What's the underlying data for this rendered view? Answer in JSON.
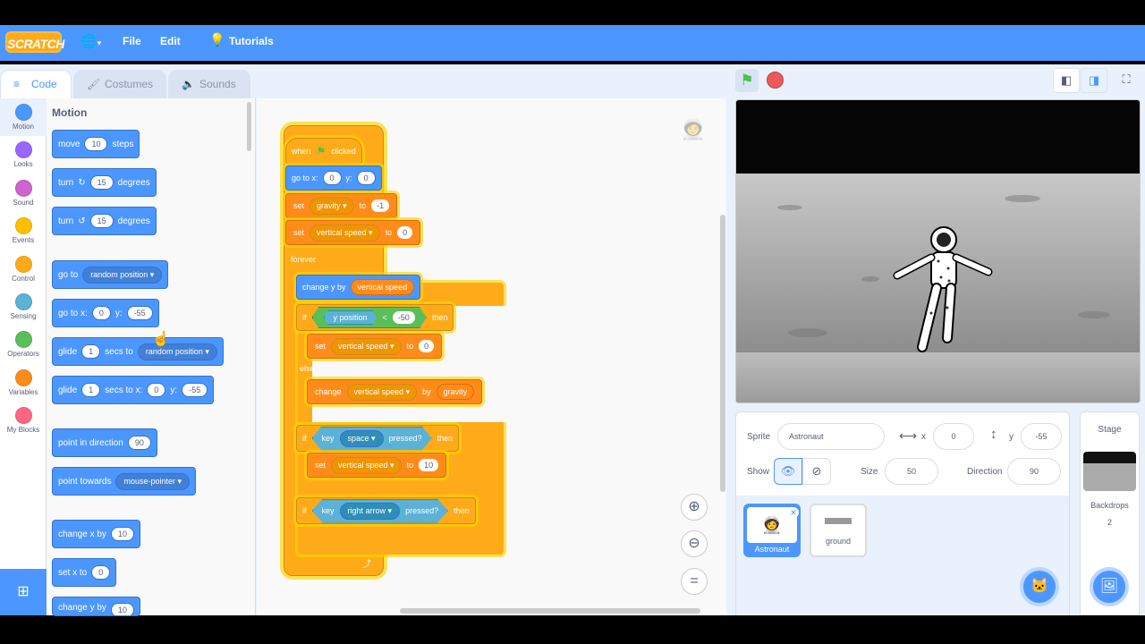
{
  "menu": {
    "logo": "SCRATCH",
    "globe_icon": "globe-icon",
    "file": "File",
    "edit": "Edit",
    "tutorials": "Tutorials"
  },
  "tabs": {
    "code": "Code",
    "costumes": "Costumes",
    "sounds": "Sounds"
  },
  "categories": [
    {
      "label": "Motion",
      "color": "#4c97ff"
    },
    {
      "label": "Looks",
      "color": "#9966ff"
    },
    {
      "label": "Sound",
      "color": "#cf63cf"
    },
    {
      "label": "Events",
      "color": "#ffbf00"
    },
    {
      "label": "Control",
      "color": "#ffab19"
    },
    {
      "label": "Sensing",
      "color": "#5cb1d6"
    },
    {
      "label": "Operators",
      "color": "#59c059"
    },
    {
      "label": "Variables",
      "color": "#ff8c1a"
    },
    {
      "label": "My Blocks",
      "color": "#ff6680"
    }
  ],
  "palette": {
    "title": "Motion",
    "move": {
      "a": "move",
      "v": "10",
      "b": "steps"
    },
    "turn_right": {
      "a": "turn",
      "v": "15",
      "b": "degrees"
    },
    "turn_left": {
      "a": "turn",
      "v": "15",
      "b": "degrees"
    },
    "goto": {
      "a": "go to",
      "d": "random position"
    },
    "gotoxy": {
      "a": "go to x:",
      "x": "0",
      "b": "y:",
      "y": "-55"
    },
    "glide": {
      "a": "glide",
      "v": "1",
      "b": "secs to",
      "d": "random position"
    },
    "glidexy": {
      "a": "glide",
      "v": "1",
      "b": "secs to x:",
      "x": "0",
      "c": "y:",
      "y": "-55"
    },
    "point_dir": {
      "a": "point in direction",
      "v": "90"
    },
    "point_towards": {
      "a": "point towards",
      "d": "mouse-pointer"
    },
    "change_x": {
      "a": "change x by",
      "v": "10"
    },
    "set_x": {
      "a": "set x to",
      "v": "0"
    },
    "change_y": {
      "a": "change y by",
      "v": "10"
    }
  },
  "script": {
    "hat": {
      "a": "when",
      "b": "clicked"
    },
    "gotoxy": {
      "a": "go to x:",
      "x": "0",
      "b": "y:",
      "y": "0"
    },
    "set_gravity": {
      "a": "set",
      "d": "gravity",
      "b": "to",
      "v": "-1"
    },
    "set_vs": {
      "a": "set",
      "d": "vertical speed",
      "b": "to",
      "v": "0"
    },
    "forever": "forever",
    "change_y": {
      "a": "change y by",
      "v": "vertical speed"
    },
    "if1": {
      "a": "if",
      "s": "y position",
      "op": "<",
      "v": "-50",
      "b": "then"
    },
    "set_vs2": {
      "a": "set",
      "d": "vertical speed",
      "b": "to",
      "v": "0"
    },
    "else": "else",
    "change_vs": {
      "a": "change",
      "d": "vertical speed",
      "b": "by",
      "v": "gravity"
    },
    "if2": {
      "a": "if",
      "k": "key",
      "d": "space",
      "p": "pressed?",
      "b": "then"
    },
    "set_vs3": {
      "a": "set",
      "d": "vertical speed",
      "b": "to",
      "v": "10"
    },
    "if3": {
      "a": "if",
      "k": "key",
      "d": "right arrow",
      "p": "pressed?",
      "b": "then"
    }
  },
  "sprite": {
    "label": "Sprite",
    "name": "Astronaut",
    "x_label": "x",
    "x": "0",
    "y_label": "y",
    "y": "-55",
    "show_label": "Show",
    "size_label": "Size",
    "size": "50",
    "direction_label": "Direction",
    "direction": "90",
    "list": [
      {
        "name": "Astronaut",
        "selected": true
      },
      {
        "name": "ground",
        "selected": false
      }
    ]
  },
  "stage_panel": {
    "title": "Stage",
    "backdrops_label": "Backdrops",
    "backdrops_count": "2"
  }
}
